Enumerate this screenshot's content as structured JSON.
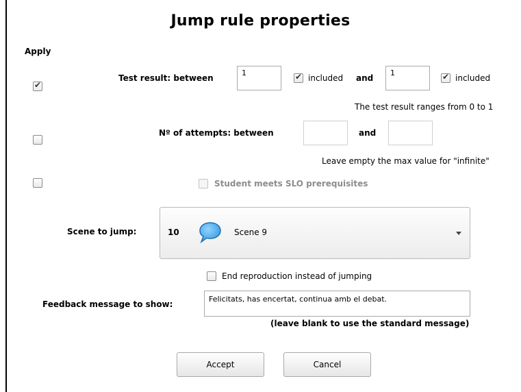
{
  "dialog": {
    "title": "Jump rule properties",
    "apply_label": "Apply"
  },
  "test_result": {
    "label": "Test result: between",
    "min_value": "1",
    "min_included_label": "included",
    "and_label": "and",
    "max_value": "1",
    "max_included_label": "included",
    "hint": "The test result ranges from 0 to 1",
    "applied": true,
    "min_included": true,
    "max_included": true
  },
  "attempts": {
    "label": "Nº of attempts: between",
    "min_value": "",
    "and_label": "and",
    "max_value": "",
    "hint": "Leave empty the max value for \"infinite\"",
    "applied": false
  },
  "slo": {
    "label": "Student meets SLO prerequisites",
    "applied": false
  },
  "scene": {
    "label": "Scene to jump:",
    "number": "10",
    "name": "Scene 9",
    "icon": "speech-bubble-icon"
  },
  "end_reproduction": {
    "label": "End reproduction instead of jumping",
    "checked": false
  },
  "feedback": {
    "label": "Feedback message to show:",
    "value": "Felicitats, has encertat, continua amb el debat.",
    "hint": "(leave blank to use the standard message)"
  },
  "buttons": {
    "accept": "Accept",
    "cancel": "Cancel"
  },
  "colors": {
    "bubble_fill": "#3a9be0",
    "bubble_stroke": "#1c6fb3"
  }
}
